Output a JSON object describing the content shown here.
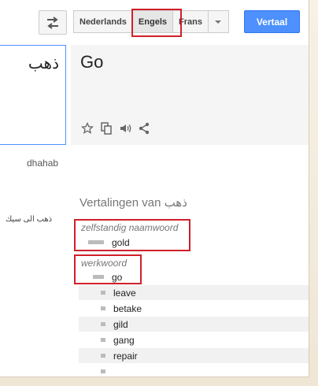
{
  "toolbar": {
    "languages": [
      "Nederlands",
      "Engels",
      "Frans"
    ],
    "translate_label": "Vertaal"
  },
  "source": {
    "text": "ذهب",
    "transliteration": "dhahab",
    "example": "ذهب الى سيك"
  },
  "result": {
    "text": "Go"
  },
  "dictionary": {
    "title": "Vertalingen van ذهب",
    "noun": {
      "pos": "zelfstandig naamwoord",
      "words": [
        "gold"
      ]
    },
    "verb": {
      "pos": "werkwoord",
      "words": [
        "go",
        "leave",
        "betake",
        "gild",
        "gang",
        "repair"
      ]
    }
  },
  "colors": {
    "accent": "#4d90fe",
    "highlight": "#d0202a"
  }
}
